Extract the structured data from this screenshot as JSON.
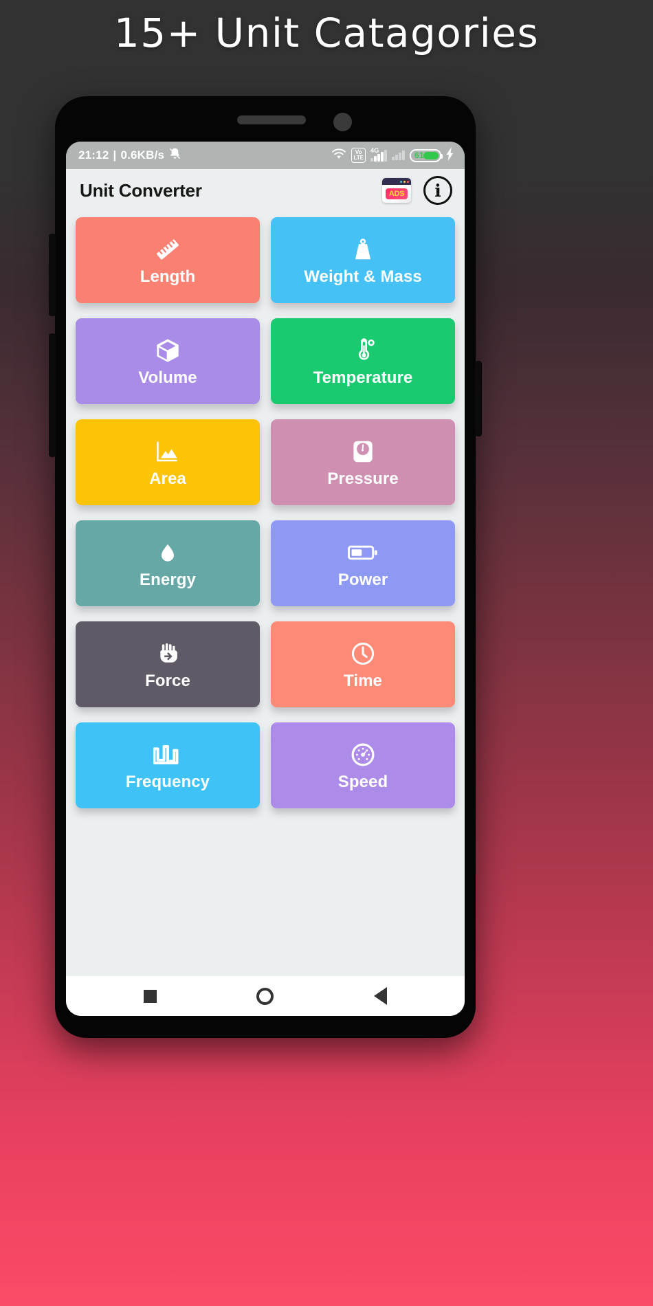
{
  "promo": {
    "title": "15+ Unit Catagories",
    "background_top": "#323232",
    "background_bottom": "#fb4b67"
  },
  "status_bar": {
    "time": "21:12",
    "separator": "|",
    "network_speed": "0.6KB/s",
    "mute_icon": "bell-muted-icon",
    "wifi_icon": "wifi-icon",
    "volte_top": "Vo",
    "volte_bottom": "LTE",
    "signal_label": "4G",
    "battery_percent": "61",
    "charging_icon": "lightning-bolt-icon",
    "battery_color": "#31c84c",
    "bar_color": "#b0b5b4"
  },
  "app_bar": {
    "title": "Unit Converter",
    "ads_label": "ADS",
    "info_label": "i"
  },
  "grid": {
    "tiles": [
      {
        "label": "Length",
        "icon": "ruler-icon",
        "color": "#fa8072"
      },
      {
        "label": "Weight & Mass",
        "icon": "weight-icon",
        "color": "#45c1f5"
      },
      {
        "label": "Volume",
        "icon": "box-icon",
        "color": "#a98ce8"
      },
      {
        "label": "Temperature",
        "icon": "thermometer-icon",
        "color": "#19ca70"
      },
      {
        "label": "Area",
        "icon": "mountain-icon",
        "color": "#fcc307"
      },
      {
        "label": "Pressure",
        "icon": "gauge-scale-icon",
        "color": "#cf8fb1"
      },
      {
        "label": "Energy",
        "icon": "flame-drop-icon",
        "color": "#66a8a6"
      },
      {
        "label": "Power",
        "icon": "battery-icon",
        "color": "#8e99f3"
      },
      {
        "label": "Force",
        "icon": "fist-icon",
        "color": "#5f5a66"
      },
      {
        "label": "Time",
        "icon": "clock-icon",
        "color": "#fc8a76"
      },
      {
        "label": "Frequency",
        "icon": "waveform-icon",
        "color": "#3fc2f5"
      },
      {
        "label": "Speed",
        "icon": "speedometer-icon",
        "color": "#ac8ce8"
      }
    ]
  },
  "nav_bar": {
    "recents": "square-icon",
    "home": "circle-icon",
    "back": "triangle-back-icon"
  }
}
